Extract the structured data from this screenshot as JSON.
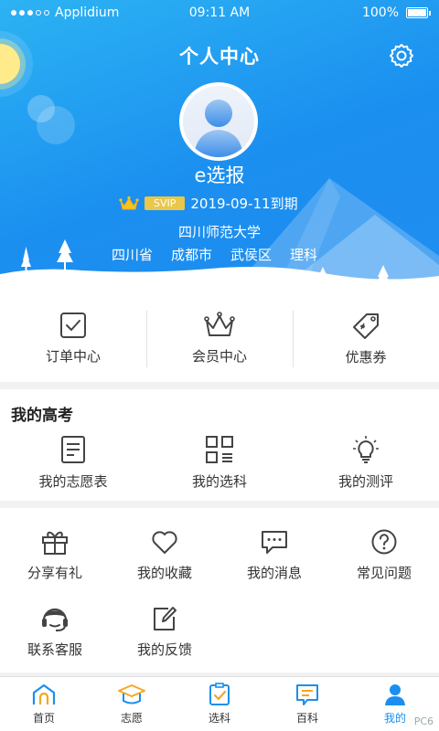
{
  "status_bar": {
    "carrier": "Applidium",
    "time": "09:11 AM",
    "battery": "100%"
  },
  "header": {
    "title": "个人中心",
    "settings_icon": "gear-icon"
  },
  "profile": {
    "username": "e选报",
    "vip_label": "SVIP",
    "vip_expiry": "2019-09-11到期",
    "school": "四川师范大学",
    "region": [
      "四川省",
      "成都市",
      "武侯区",
      "理科"
    ]
  },
  "quick_actions": [
    {
      "label": "订单中心",
      "icon": "order-check-icon"
    },
    {
      "label": "会员中心",
      "icon": "crown-icon"
    },
    {
      "label": "优惠券",
      "icon": "coupon-tag-icon"
    }
  ],
  "gaokao": {
    "title": "我的高考",
    "items": [
      {
        "label": "我的志愿表",
        "icon": "document-list-icon"
      },
      {
        "label": "我的选科",
        "icon": "grid-list-icon"
      },
      {
        "label": "我的测评",
        "icon": "lightbulb-icon"
      }
    ]
  },
  "services": [
    {
      "label": "分享有礼",
      "icon": "gift-icon"
    },
    {
      "label": "我的收藏",
      "icon": "heart-icon"
    },
    {
      "label": "我的消息",
      "icon": "message-icon"
    },
    {
      "label": "常见问题",
      "icon": "question-icon"
    },
    {
      "label": "联系客服",
      "icon": "headset-icon"
    },
    {
      "label": "我的反馈",
      "icon": "edit-icon"
    }
  ],
  "tabbar": {
    "active": "我的",
    "tabs": [
      {
        "label": "首页",
        "icon": "home-icon"
      },
      {
        "label": "志愿",
        "icon": "graduation-cap-icon"
      },
      {
        "label": "选科",
        "icon": "checklist-icon"
      },
      {
        "label": "百科",
        "icon": "book-icon"
      },
      {
        "label": "我的",
        "icon": "user-icon"
      }
    ]
  },
  "watermark": "PC6",
  "colors": {
    "primary": "#1b8ff0",
    "hero_light": "#2cb3f3",
    "vip_gold": "#e8c74a",
    "accent_orange": "#f5a623"
  }
}
